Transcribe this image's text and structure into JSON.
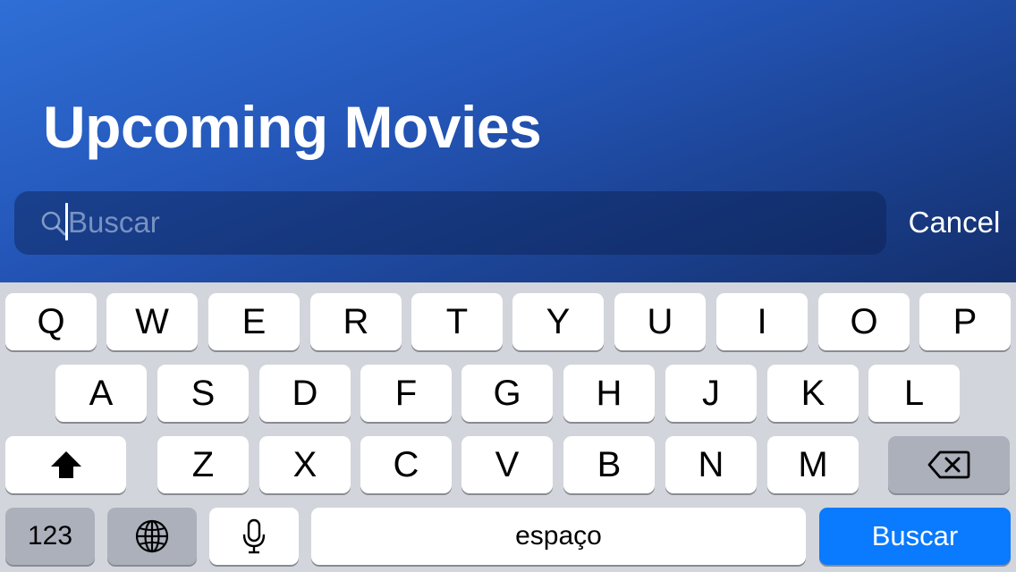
{
  "header": {
    "title": "Upcoming Movies"
  },
  "search": {
    "placeholder": "Buscar",
    "value": "",
    "cancel_label": "Cancel"
  },
  "keyboard": {
    "row1": [
      "Q",
      "W",
      "E",
      "R",
      "T",
      "Y",
      "U",
      "I",
      "O",
      "P"
    ],
    "row2": [
      "A",
      "S",
      "D",
      "F",
      "G",
      "H",
      "J",
      "K",
      "L"
    ],
    "row3": [
      "Z",
      "X",
      "C",
      "V",
      "B",
      "N",
      "M"
    ],
    "numbers_label": "123",
    "space_label": "espaço",
    "return_label": "Buscar",
    "icons": {
      "shift": "shift-icon",
      "delete": "delete-icon",
      "globe": "globe-icon",
      "mic": "microphone-icon"
    }
  },
  "colors": {
    "header_gradient_start": "#2f6fd6",
    "header_gradient_end": "#142f6d",
    "keyboard_bg": "#d2d5db",
    "key_bg": "#ffffff",
    "dark_key_bg": "#abb0bb",
    "return_key_bg": "#0a7aff"
  }
}
